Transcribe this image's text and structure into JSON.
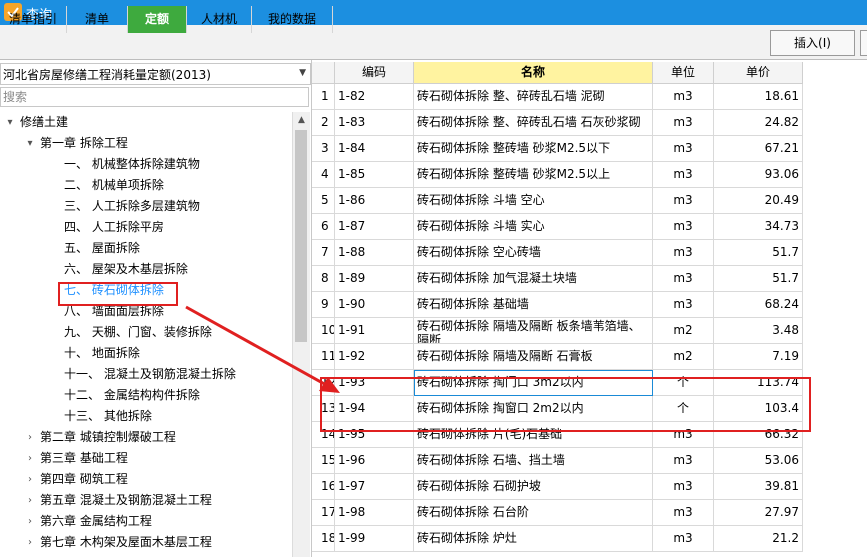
{
  "window": {
    "title": "查询"
  },
  "tabs": [
    {
      "label": "清单指引",
      "active": false
    },
    {
      "label": "清单",
      "active": false
    },
    {
      "label": "定额",
      "active": true
    },
    {
      "label": "人材机",
      "active": false
    },
    {
      "label": "我的数据",
      "active": false
    }
  ],
  "toolbar": {
    "insert_label": "插入(I)"
  },
  "left": {
    "quota_select": "河北省房屋修缮工程消耗量定额(2013)",
    "search_placeholder": "搜索",
    "tree": [
      {
        "label": "修缮土建",
        "level": 0,
        "toggle": "▾"
      },
      {
        "label": "第一章 拆除工程",
        "level": 1,
        "toggle": "▾"
      },
      {
        "label": "一、 机械整体拆除建筑物",
        "level": 2,
        "toggle": ""
      },
      {
        "label": "二、 机械单项拆除",
        "level": 2,
        "toggle": ""
      },
      {
        "label": "三、 人工拆除多层建筑物",
        "level": 2,
        "toggle": ""
      },
      {
        "label": "四、 人工拆除平房",
        "level": 2,
        "toggle": ""
      },
      {
        "label": "五、 屋面拆除",
        "level": 2,
        "toggle": ""
      },
      {
        "label": "六、 屋架及木基层拆除",
        "level": 2,
        "toggle": ""
      },
      {
        "label": "七、 砖石砌体拆除",
        "level": 2,
        "toggle": "",
        "selected": true
      },
      {
        "label": "八、 墙面面层拆除",
        "level": 2,
        "toggle": ""
      },
      {
        "label": "九、 天棚、门窗、装修拆除",
        "level": 2,
        "toggle": ""
      },
      {
        "label": "十、 地面拆除",
        "level": 2,
        "toggle": ""
      },
      {
        "label": "十一、 混凝土及钢筋混凝土拆除",
        "level": 2,
        "toggle": ""
      },
      {
        "label": "十二、 金属结构构件拆除",
        "level": 2,
        "toggle": ""
      },
      {
        "label": "十三、 其他拆除",
        "level": 2,
        "toggle": ""
      },
      {
        "label": "第二章 城镇控制爆破工程",
        "level": 1,
        "toggle": "›"
      },
      {
        "label": "第三章 基础工程",
        "level": 1,
        "toggle": "›"
      },
      {
        "label": "第四章 砌筑工程",
        "level": 1,
        "toggle": "›"
      },
      {
        "label": "第五章 混凝土及钢筋混凝土工程",
        "level": 1,
        "toggle": "›"
      },
      {
        "label": "第六章 金属结构工程",
        "level": 1,
        "toggle": "›"
      },
      {
        "label": "第七章 木构架及屋面木基层工程",
        "level": 1,
        "toggle": "›"
      }
    ]
  },
  "grid": {
    "headers": {
      "num": "",
      "code": "编码",
      "name": "名称",
      "unit": "单位",
      "price": "单价"
    },
    "rows": [
      {
        "num": "1",
        "code": "1-82",
        "name": "砖石砌体拆除 整、碎砖乱石墙 泥砌",
        "unit": "m3",
        "price": "18.61"
      },
      {
        "num": "2",
        "code": "1-83",
        "name": "砖石砌体拆除 整、碎砖乱石墙 石灰砂浆砌",
        "unit": "m3",
        "price": "24.82"
      },
      {
        "num": "3",
        "code": "1-84",
        "name": "砖石砌体拆除 整砖墙 砂浆M2.5以下",
        "unit": "m3",
        "price": "67.21"
      },
      {
        "num": "4",
        "code": "1-85",
        "name": "砖石砌体拆除 整砖墙 砂浆M2.5以上",
        "unit": "m3",
        "price": "93.06"
      },
      {
        "num": "5",
        "code": "1-86",
        "name": "砖石砌体拆除 斗墙 空心",
        "unit": "m3",
        "price": "20.49"
      },
      {
        "num": "6",
        "code": "1-87",
        "name": "砖石砌体拆除 斗墙 实心",
        "unit": "m3",
        "price": "34.73"
      },
      {
        "num": "7",
        "code": "1-88",
        "name": "砖石砌体拆除 空心砖墙",
        "unit": "m3",
        "price": "51.7"
      },
      {
        "num": "8",
        "code": "1-89",
        "name": "砖石砌体拆除 加气混凝土块墙",
        "unit": "m3",
        "price": "51.7"
      },
      {
        "num": "9",
        "code": "1-90",
        "name": "砖石砌体拆除 基础墙",
        "unit": "m3",
        "price": "68.24"
      },
      {
        "num": "10",
        "code": "1-91",
        "name": "砖石砌体拆除 隔墙及隔断 板条墙苇箔墙、隔断",
        "unit": "m2",
        "price": "3.48",
        "wrap": true
      },
      {
        "num": "11",
        "code": "1-92",
        "name": "砖石砌体拆除 隔墙及隔断 石膏板",
        "unit": "m2",
        "price": "7.19"
      },
      {
        "num": "12",
        "code": "1-93",
        "name": "砖石砌体拆除 掏门口 3m2以内",
        "unit": "个",
        "price": "113.74",
        "focus": true
      },
      {
        "num": "13",
        "code": "1-94",
        "name": "砖石砌体拆除 掏窗口 2m2以内",
        "unit": "个",
        "price": "103.4"
      },
      {
        "num": "14",
        "code": "1-95",
        "name": "砖石砌体拆除 片(毛)石基础",
        "unit": "m3",
        "price": "66.32"
      },
      {
        "num": "15",
        "code": "1-96",
        "name": "砖石砌体拆除 石墙、挡土墙",
        "unit": "m3",
        "price": "53.06"
      },
      {
        "num": "16",
        "code": "1-97",
        "name": "砖石砌体拆除 石砌护坡",
        "unit": "m3",
        "price": "39.81"
      },
      {
        "num": "17",
        "code": "1-98",
        "name": "砖石砌体拆除 石台阶",
        "unit": "m3",
        "price": "27.97"
      },
      {
        "num": "18",
        "code": "1-99",
        "name": "砖石砌体拆除 炉灶",
        "unit": "m3",
        "price": "21.2"
      }
    ]
  },
  "colors": {
    "titlebar": "#1c8fe0",
    "active_tab": "#3eaa3e",
    "annotation": "#e02020",
    "selected_tree": "#1e90ff"
  }
}
